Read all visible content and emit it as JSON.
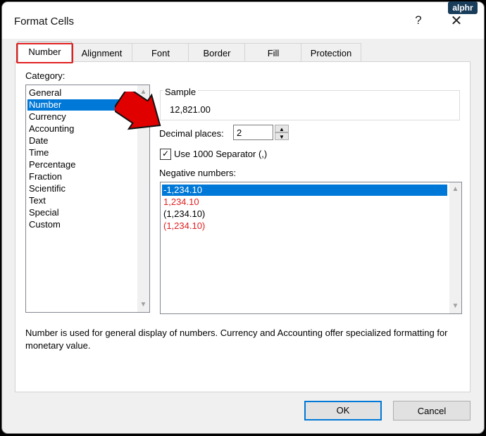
{
  "window": {
    "title": "Format Cells",
    "help": "?",
    "close": "✕"
  },
  "watermark": "alphr",
  "tabs": [
    {
      "label": "Number"
    },
    {
      "label": "Alignment"
    },
    {
      "label": "Font"
    },
    {
      "label": "Border"
    },
    {
      "label": "Fill"
    },
    {
      "label": "Protection"
    }
  ],
  "active_tab": "Number",
  "category": {
    "label": "Category:",
    "items": [
      "General",
      "Number",
      "Currency",
      "Accounting",
      "Date",
      "Time",
      "Percentage",
      "Fraction",
      "Scientific",
      "Text",
      "Special",
      "Custom"
    ],
    "selected": "Number"
  },
  "sample": {
    "label": "Sample",
    "value": "12,821.00"
  },
  "decimal_places": {
    "label": "Decimal places:",
    "value": "2"
  },
  "separator": {
    "label": "Use 1000 Separator (,)",
    "checked": true
  },
  "negative_numbers": {
    "label": "Negative numbers:",
    "items": [
      {
        "text": "-1,234.10",
        "color": "#000000"
      },
      {
        "text": "1,234.10",
        "color": "#e02020"
      },
      {
        "text": "(1,234.10)",
        "color": "#000000"
      },
      {
        "text": "(1,234.10)",
        "color": "#e02020"
      }
    ],
    "selected": "-1,234.10"
  },
  "description": "Number is used for general display of numbers.  Currency and Accounting offer specialized formatting for monetary value.",
  "buttons": {
    "ok": "OK",
    "cancel": "Cancel"
  },
  "colors": {
    "selection": "#0078d7",
    "highlight_outline": "#e02020",
    "arrow": "#e00000"
  }
}
